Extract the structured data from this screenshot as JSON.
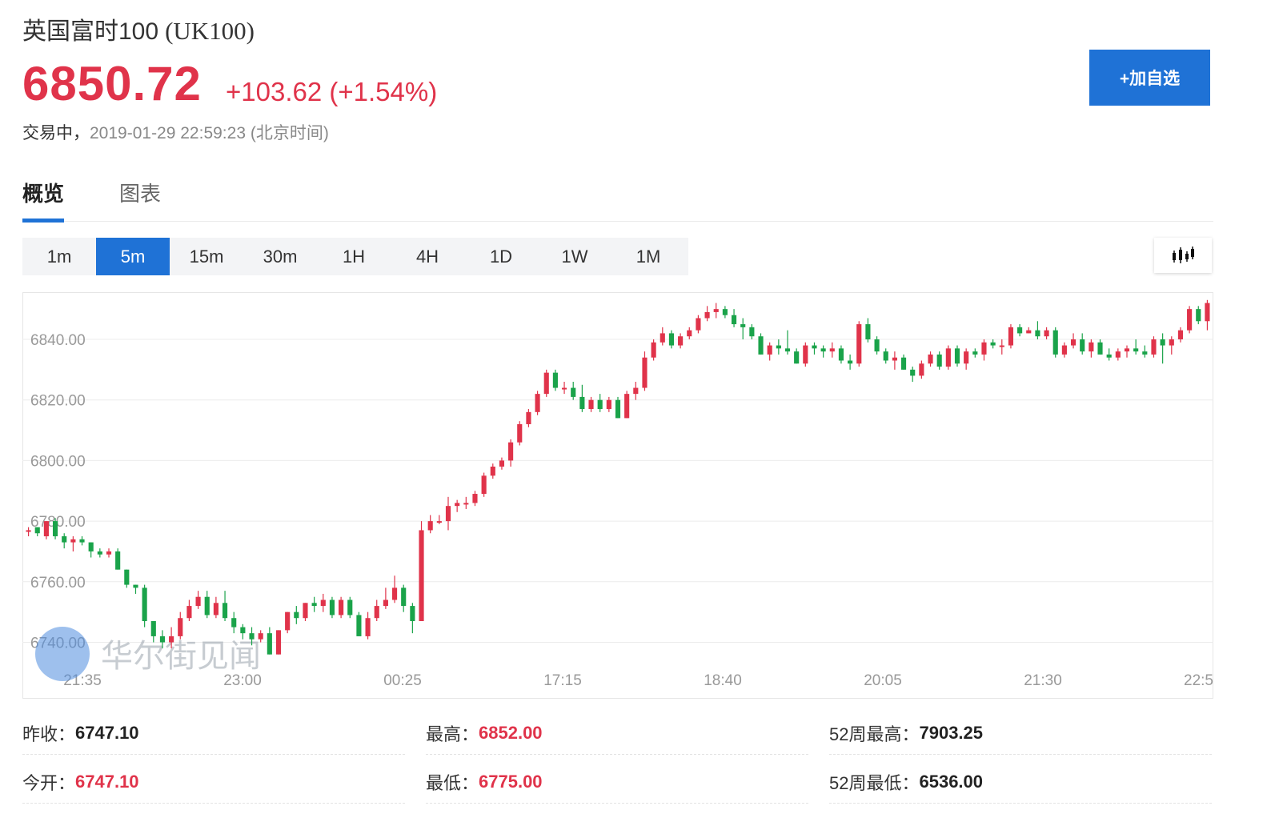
{
  "header": {
    "name": "英国富时100",
    "code": "(UK100)",
    "price": "6850.72",
    "change": "+103.62 (+1.54%)",
    "status_label": "交易中，",
    "timestamp": "2019-01-29 22:59:23 (北京时间)",
    "add_button": "+加自选"
  },
  "tabs": [
    {
      "label": "概览",
      "active": true
    },
    {
      "label": "图表",
      "active": false
    }
  ],
  "periods": [
    "1m",
    "5m",
    "15m",
    "30m",
    "1H",
    "4H",
    "1D",
    "1W",
    "1M"
  ],
  "active_period": "5m",
  "watermark": "华尔街见闻",
  "colors": {
    "up": "#e0334a",
    "down": "#1aa34a",
    "accent": "#1f72d6"
  },
  "chart_data": {
    "type": "candlestick",
    "y_ticks": [
      "6740.00",
      "6760.00",
      "6780.00",
      "6800.00",
      "6820.00",
      "6840.00"
    ],
    "x_ticks": [
      "21:35",
      "23:00",
      "00:25",
      "17:15",
      "18:40",
      "20:05",
      "21:30",
      "22:5"
    ],
    "ylim": [
      6733,
      6854
    ],
    "grid": true,
    "candles": [
      [
        6777,
        6777,
        6778,
        6775
      ],
      [
        6778,
        6776,
        6778,
        6775
      ],
      [
        6775,
        6780,
        6780,
        6774
      ],
      [
        6780,
        6775,
        6781,
        6774
      ],
      [
        6775,
        6773,
        6776,
        6771
      ],
      [
        6773,
        6774,
        6775,
        6770
      ],
      [
        6774,
        6773,
        6775,
        6772
      ],
      [
        6773,
        6770,
        6773,
        6768
      ],
      [
        6770,
        6769,
        6771,
        6768
      ],
      [
        6769,
        6770,
        6771,
        6768
      ],
      [
        6770,
        6764,
        6771,
        6764
      ],
      [
        6764,
        6759,
        6764,
        6758
      ],
      [
        6759,
        6758,
        6759,
        6756
      ],
      [
        6758,
        6747,
        6759,
        6745
      ],
      [
        6747,
        6742,
        6747,
        6740
      ],
      [
        6742,
        6740,
        6744,
        6738
      ],
      [
        6740,
        6742,
        6745,
        6738
      ],
      [
        6742,
        6748,
        6750,
        6741
      ],
      [
        6748,
        6752,
        6754,
        6747
      ],
      [
        6752,
        6755,
        6757,
        6751
      ],
      [
        6755,
        6749,
        6757,
        6748
      ],
      [
        6749,
        6753,
        6755,
        6748
      ],
      [
        6753,
        6748,
        6757,
        6747
      ],
      [
        6748,
        6745,
        6750,
        6743
      ],
      [
        6745,
        6743,
        6746,
        6741
      ],
      [
        6743,
        6741,
        6745,
        6739
      ],
      [
        6741,
        6743,
        6744,
        6740
      ],
      [
        6743,
        6736,
        6745,
        6736
      ],
      [
        6736,
        6744,
        6744,
        6736
      ],
      [
        6744,
        6750,
        6750,
        6743
      ],
      [
        6750,
        6748,
        6752,
        6746
      ],
      [
        6748,
        6753,
        6753,
        6747
      ],
      [
        6753,
        6752,
        6755,
        6750
      ],
      [
        6752,
        6754,
        6756,
        6750
      ],
      [
        6754,
        6749,
        6755,
        6748
      ],
      [
        6749,
        6754,
        6755,
        6748
      ],
      [
        6754,
        6749,
        6755,
        6748
      ],
      [
        6749,
        6742,
        6750,
        6742
      ],
      [
        6742,
        6748,
        6750,
        6741
      ],
      [
        6748,
        6752,
        6754,
        6747
      ],
      [
        6752,
        6754,
        6758,
        6751
      ],
      [
        6754,
        6758,
        6762,
        6753
      ],
      [
        6758,
        6752,
        6759,
        6750
      ],
      [
        6752,
        6747,
        6753,
        6743
      ],
      [
        6747,
        6777,
        6780,
        6775
      ],
      [
        6777,
        6780,
        6782,
        6776
      ],
      [
        6780,
        6780,
        6782,
        6779
      ],
      [
        6780,
        6785,
        6788,
        6777
      ],
      [
        6785,
        6786,
        6787,
        6783
      ],
      [
        6786,
        6786,
        6788,
        6784
      ],
      [
        6786,
        6789,
        6790,
        6785
      ],
      [
        6789,
        6795,
        6796,
        6788
      ],
      [
        6795,
        6798,
        6799,
        6794
      ],
      [
        6798,
        6800,
        6801,
        6797
      ],
      [
        6800,
        6806,
        6807,
        6798
      ],
      [
        6806,
        6812,
        6813,
        6805
      ],
      [
        6812,
        6816,
        6817,
        6811
      ],
      [
        6816,
        6822,
        6823,
        6815
      ],
      [
        6822,
        6829,
        6830,
        6821
      ],
      [
        6829,
        6824,
        6830,
        6823
      ],
      [
        6824,
        6824,
        6826,
        6822
      ],
      [
        6824,
        6821,
        6826,
        6820
      ],
      [
        6821,
        6817,
        6825,
        6816
      ],
      [
        6817,
        6820,
        6821,
        6816
      ],
      [
        6820,
        6817,
        6822,
        6816
      ],
      [
        6817,
        6820,
        6821,
        6816
      ],
      [
        6820,
        6814,
        6821,
        6814
      ],
      [
        6814,
        6822,
        6823,
        6814
      ],
      [
        6822,
        6824,
        6826,
        6820
      ],
      [
        6824,
        6834,
        6836,
        6823
      ],
      [
        6834,
        6839,
        6840,
        6833
      ],
      [
        6839,
        6842,
        6844,
        6838
      ],
      [
        6842,
        6838,
        6843,
        6837
      ],
      [
        6838,
        6841,
        6842,
        6837
      ],
      [
        6841,
        6843,
        6844,
        6840
      ],
      [
        6843,
        6847,
        6848,
        6842
      ],
      [
        6847,
        6849,
        6851,
        6846
      ],
      [
        6849,
        6850,
        6852,
        6847
      ],
      [
        6850,
        6848,
        6851,
        6847
      ],
      [
        6848,
        6845,
        6850,
        6844
      ],
      [
        6845,
        6844,
        6847,
        6840
      ],
      [
        6844,
        6841,
        6845,
        6840
      ],
      [
        6841,
        6835,
        6842,
        6835
      ],
      [
        6835,
        6838,
        6839,
        6833
      ],
      [
        6838,
        6837,
        6840,
        6835
      ],
      [
        6837,
        6836,
        6843,
        6835
      ],
      [
        6836,
        6832,
        6837,
        6832
      ],
      [
        6832,
        6838,
        6839,
        6831
      ],
      [
        6838,
        6837,
        6839,
        6835
      ],
      [
        6837,
        6836,
        6838,
        6834
      ],
      [
        6836,
        6837,
        6839,
        6834
      ],
      [
        6837,
        6833,
        6838,
        6832
      ],
      [
        6833,
        6832,
        6835,
        6830
      ],
      [
        6832,
        6845,
        6846,
        6831
      ],
      [
        6845,
        6840,
        6847,
        6839
      ],
      [
        6840,
        6836,
        6841,
        6835
      ],
      [
        6836,
        6833,
        6837,
        6832
      ],
      [
        6833,
        6834,
        6836,
        6830
      ],
      [
        6834,
        6830,
        6835,
        6830
      ],
      [
        6830,
        6828,
        6831,
        6826
      ],
      [
        6828,
        6832,
        6833,
        6827
      ],
      [
        6832,
        6835,
        6836,
        6831
      ],
      [
        6835,
        6831,
        6836,
        6830
      ],
      [
        6831,
        6837,
        6838,
        6830
      ],
      [
        6837,
        6832,
        6838,
        6831
      ],
      [
        6832,
        6836,
        6837,
        6830
      ],
      [
        6836,
        6835,
        6837,
        6834
      ],
      [
        6835,
        6839,
        6840,
        6833
      ],
      [
        6839,
        6838,
        6840,
        6837
      ],
      [
        6838,
        6838,
        6840,
        6835
      ],
      [
        6838,
        6844,
        6845,
        6837
      ],
      [
        6844,
        6842,
        6845,
        6841
      ],
      [
        6842,
        6843,
        6844,
        6842
      ],
      [
        6843,
        6841,
        6846,
        6840
      ],
      [
        6841,
        6843,
        6844,
        6840
      ],
      [
        6843,
        6835,
        6844,
        6834
      ],
      [
        6835,
        6838,
        6839,
        6834
      ],
      [
        6838,
        6840,
        6842,
        6837
      ],
      [
        6840,
        6836,
        6842,
        6835
      ],
      [
        6836,
        6839,
        6840,
        6834
      ],
      [
        6839,
        6835,
        6840,
        6835
      ],
      [
        6835,
        6834,
        6837,
        6833
      ],
      [
        6834,
        6836,
        6837,
        6833
      ],
      [
        6836,
        6837,
        6838,
        6834
      ],
      [
        6837,
        6836,
        6840,
        6835
      ],
      [
        6836,
        6835,
        6838,
        6834
      ],
      [
        6835,
        6840,
        6841,
        6834
      ],
      [
        6840,
        6838,
        6842,
        6832
      ],
      [
        6838,
        6840,
        6841,
        6835
      ],
      [
        6840,
        6843,
        6844,
        6839
      ],
      [
        6843,
        6850,
        6851,
        6842
      ],
      [
        6850,
        6846,
        6851,
        6845
      ],
      [
        6846,
        6852,
        6853,
        6843
      ]
    ]
  },
  "stats": [
    [
      {
        "label": "昨收：",
        "value": "6747.10",
        "red": false
      },
      {
        "label": "最高：",
        "value": "6852.00",
        "red": true
      },
      {
        "label": "52周最高：",
        "value": "7903.25",
        "red": false
      }
    ],
    [
      {
        "label": "今开：",
        "value": "6747.10",
        "red": true
      },
      {
        "label": "最低：",
        "value": "6775.00",
        "red": true
      },
      {
        "label": "52周最低：",
        "value": "6536.00",
        "red": false
      }
    ]
  ]
}
